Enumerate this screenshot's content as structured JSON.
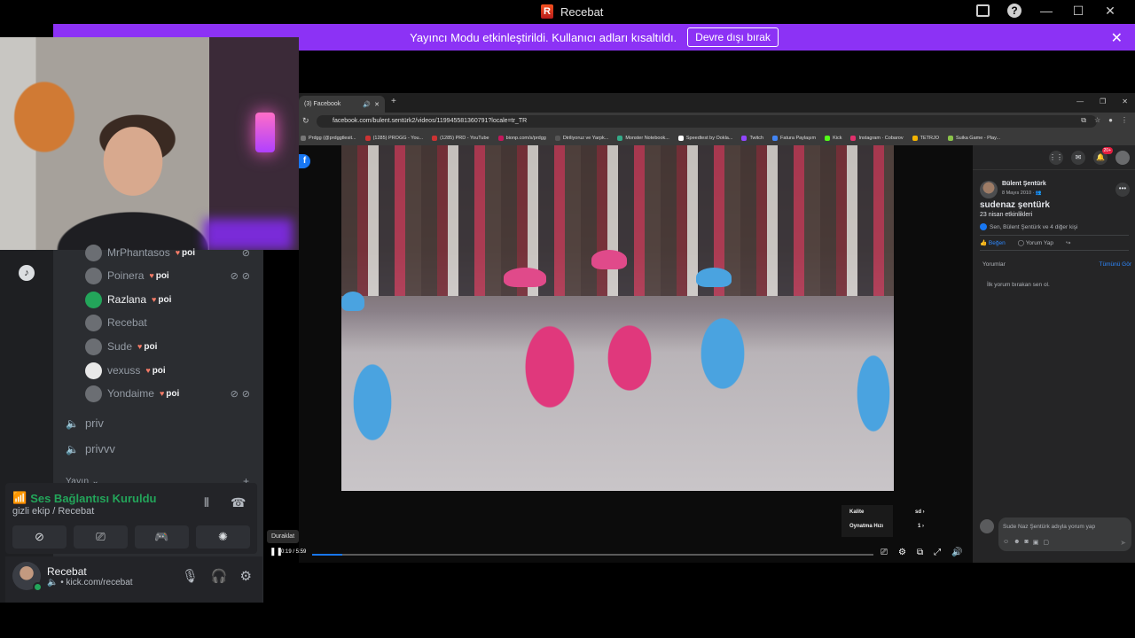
{
  "app": {
    "title": "Recebat",
    "logo_letter": "R"
  },
  "banner": {
    "message": "Yayıncı Modu etkinleştirildi. Kullanıcı adları kısaltıldı.",
    "button_label": "Devre dışı bırak",
    "close_icon": "close-icon",
    "color": "#8c32f5"
  },
  "discord": {
    "users": [
      {
        "name": "MrPhantasos",
        "badge": "poi",
        "muted": true,
        "active": false
      },
      {
        "name": "Poinera",
        "badge": "poi",
        "muted": true,
        "active": false
      },
      {
        "name": "Razlana",
        "badge": "poi",
        "muted": false,
        "active": true
      },
      {
        "name": "Recebat",
        "badge": "",
        "muted": false,
        "active": false
      },
      {
        "name": "Sude",
        "badge": "poi",
        "muted": false,
        "active": false
      },
      {
        "name": "vexuss",
        "badge": "poi",
        "muted": false,
        "active": false
      },
      {
        "name": "Yondaime",
        "badge": "poi",
        "muted": true,
        "active": false
      }
    ],
    "voice_channels": [
      "priv",
      "privvv"
    ],
    "category": "Yayın",
    "voice_panel": {
      "status": "Ses Bağlantısı Kuruldu",
      "channel": "gizli ekip / Recebat",
      "status_color": "#23a55a"
    },
    "user_panel": {
      "name": "Recebat",
      "subtitle": "• kick.com/recebat"
    }
  },
  "tooltip": "Duraklat",
  "browser": {
    "tab_title": "(3) Facebook",
    "url": "facebook.com/bulent.sentürk2/videos/119945581360791?locale=tr_TR",
    "bookmarks": [
      "Prdgg (@prdggtlesit...",
      "(1285) PROGG - You...",
      "(1285) PRD - YouTube",
      "bionp.com/s/prdgg",
      "Diriliyoruz ve Yarpk...",
      "Monster Notebook...",
      "Speedtest by Ookla...",
      "Twitch",
      "Fatura Paylaşım",
      "Kick",
      "Instagram · Cobarov",
      "TETRJO",
      "Suika Game - Play..."
    ]
  },
  "video": {
    "time": "0:19 / 5:59",
    "progress": 0.053,
    "menu": {
      "quality_label": "Kalite",
      "quality_value": "sd",
      "speed_label": "Oynatma Hızı",
      "speed_value": "1"
    }
  },
  "facebook": {
    "notifications": "20+",
    "author": "Bülent Şentürk",
    "date": "8 Mayıs 2010 · ",
    "title": "sudenaz şentürk",
    "subtitle": "23 nisan etkinlikleri",
    "likes": "Sen, Bülent Şentürk ve 4 diğer kişi",
    "like_label": "Beğen",
    "comment_label": "Yorum Yap",
    "comments_header": "Yorumlar",
    "all_comments": "Tümünü Gör",
    "empty_comments": "İlk yorum bırakan sen ol.",
    "compose_placeholder": "Sude Naz Şentürk adıyla yorum yap"
  }
}
